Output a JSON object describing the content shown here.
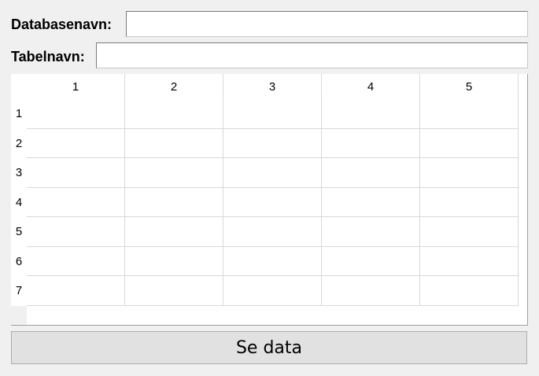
{
  "form": {
    "database_label": "Databasenavn:",
    "database_value": "",
    "table_label": "Tabelnavn:",
    "table_value": ""
  },
  "table": {
    "column_headers": [
      "1",
      "2",
      "3",
      "4",
      "5"
    ],
    "row_headers": [
      "1",
      "2",
      "3",
      "4",
      "5",
      "6",
      "7"
    ]
  },
  "actions": {
    "show_data_label": "Se data"
  }
}
